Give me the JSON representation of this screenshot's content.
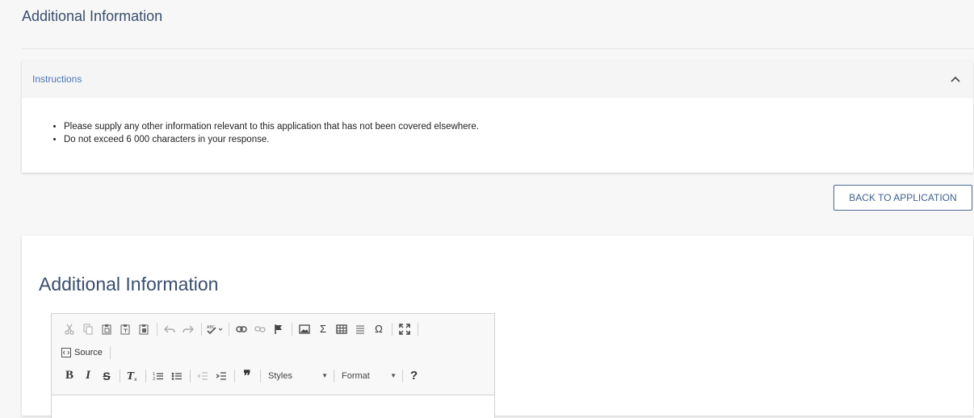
{
  "page": {
    "title": "Additional Information"
  },
  "instructions": {
    "label": "Instructions",
    "items": [
      "Please supply any other information relevant to this application that has not been covered elsewhere.",
      "Do not exceed 6 000 characters in your response."
    ]
  },
  "actions": {
    "back_label": "BACK TO APPLICATION"
  },
  "card": {
    "title": "Additional Information"
  },
  "editor": {
    "source_label": "Source",
    "styles_label": "Styles",
    "format_label": "Format",
    "help_label": "?",
    "content": ""
  },
  "colors": {
    "accent": "#4a76b9",
    "title": "#3a4e6e",
    "button_border": "#4a6a99"
  }
}
